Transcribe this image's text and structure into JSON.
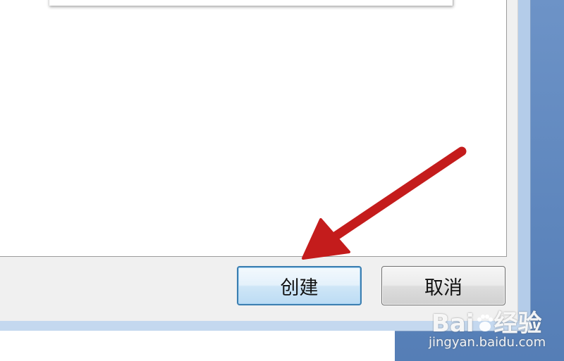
{
  "dialog": {
    "create_button_label": "创建",
    "cancel_button_label": "取消"
  },
  "watermark": {
    "logo_text_before": "Bai",
    "logo_text_after": "经验",
    "url": "jingyan.baidu.com"
  },
  "colors": {
    "arrow": "#c41c1c",
    "create_border": "#3c7fb1",
    "desktop": "#5e86bd"
  }
}
